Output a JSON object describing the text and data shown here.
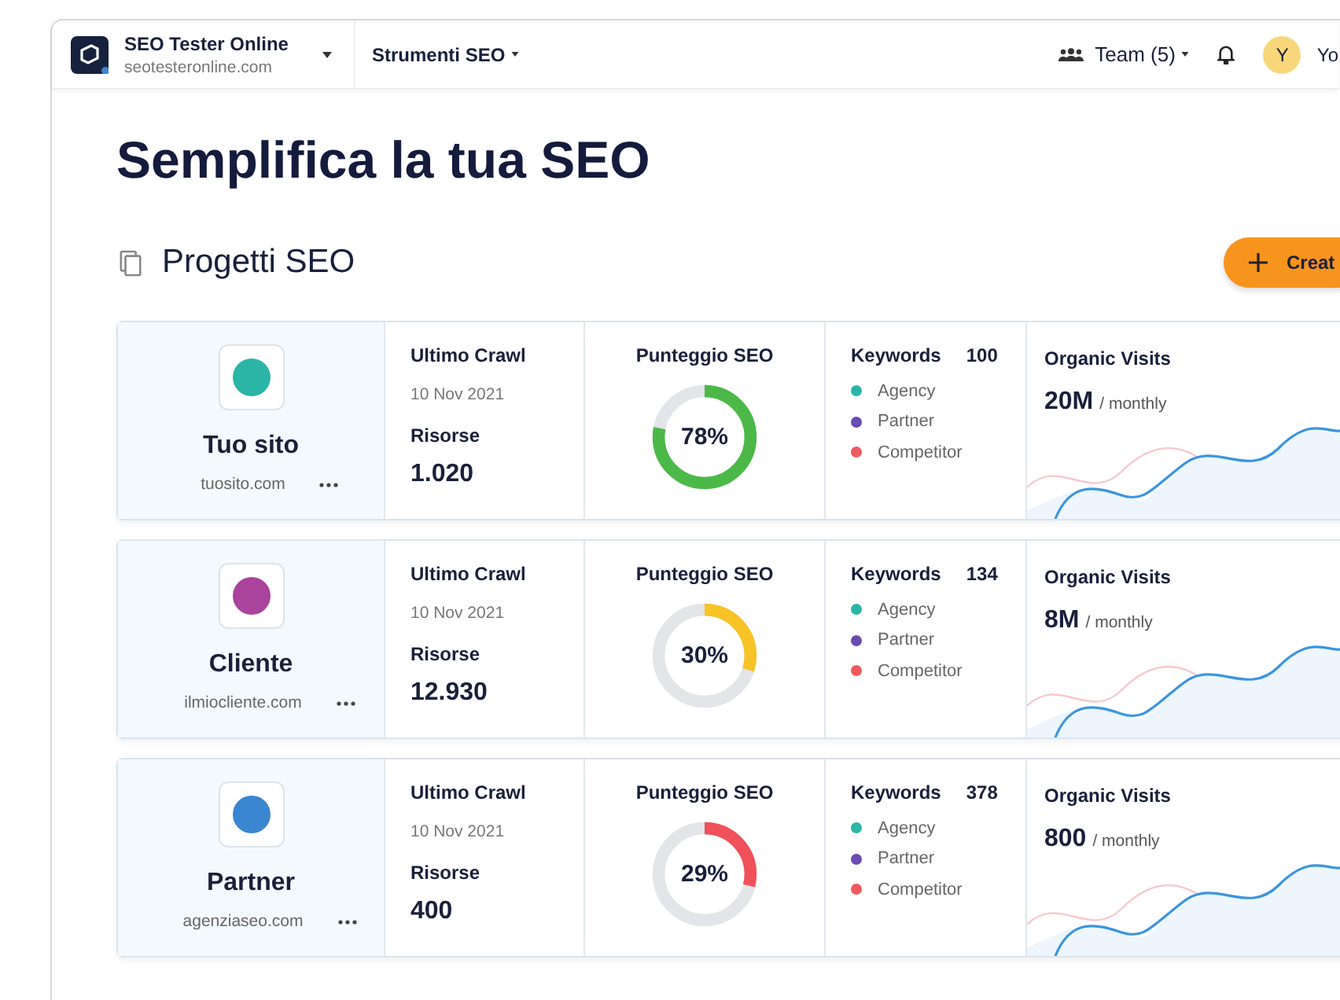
{
  "header": {
    "brand": "SEO Tester Online",
    "domain": "seotesteronline.com",
    "menu": "Strumenti SEO",
    "team": "Team (5)",
    "avatar": "Y",
    "user": "Yo"
  },
  "page_title": "Semplifica la tua SEO",
  "section": {
    "title": "Progetti SEO",
    "create_button": "Creat"
  },
  "projects": [
    {
      "name": "Tuo sito",
      "domain": "tuosito.com",
      "color": "#2bb5a6",
      "crawl_label": "Ultimo Crawl",
      "crawl_date": "10 Nov 2021",
      "resources_label": "Risorse",
      "resources": "1.020",
      "score_label": "Punteggio SEO",
      "score": "78%",
      "level": 0.78,
      "keywords_label": "Keywords",
      "keywords": "100",
      "legend": [
        {
          "label": "Agency",
          "color": "#2bb5a6"
        },
        {
          "label": "Partner",
          "color": "#6a4bb0"
        },
        {
          "label": "Competitor",
          "color": "#f05a5f"
        }
      ],
      "visits_label": "Organic Visits",
      "visits": "20M",
      "visits_unit": "/ monthly"
    },
    {
      "name": "Cliente",
      "domain": "ilmiocliente.com",
      "color": "#a9439c",
      "crawl_label": "Ultimo Crawl",
      "crawl_date": "10 Nov 2021",
      "resources_label": "Risorse",
      "resources": "12.930",
      "score_label": "Punteggio SEO",
      "score": "30%",
      "level": 0.3,
      "keywords_label": "Keywords",
      "keywords": "134",
      "legend": [
        {
          "label": "Agency",
          "color": "#2bb5a6"
        },
        {
          "label": "Partner",
          "color": "#6a4bb0"
        },
        {
          "label": "Competitor",
          "color": "#f05a5f"
        }
      ],
      "visits_label": "Organic Visits",
      "visits": "8M",
      "visits_unit": "/ monthly"
    },
    {
      "name": "Partner",
      "domain": "agenziaseo.com",
      "color": "#3a86d0",
      "crawl_label": "Ultimo Crawl",
      "crawl_date": "10 Nov 2021",
      "resources_label": "Risorse",
      "resources": "400",
      "score_label": "Punteggio SEO",
      "score": "29%",
      "level": 0.29,
      "keywords_label": "Keywords",
      "keywords": "378",
      "legend": [
        {
          "label": "Agency",
          "color": "#2bb5a6"
        },
        {
          "label": "Partner",
          "color": "#6a4bb0"
        },
        {
          "label": "Competitor",
          "color": "#f05a5f"
        }
      ],
      "visits_label": "Organic Visits",
      "visits": "800",
      "visits_unit": "/ monthly"
    }
  ]
}
